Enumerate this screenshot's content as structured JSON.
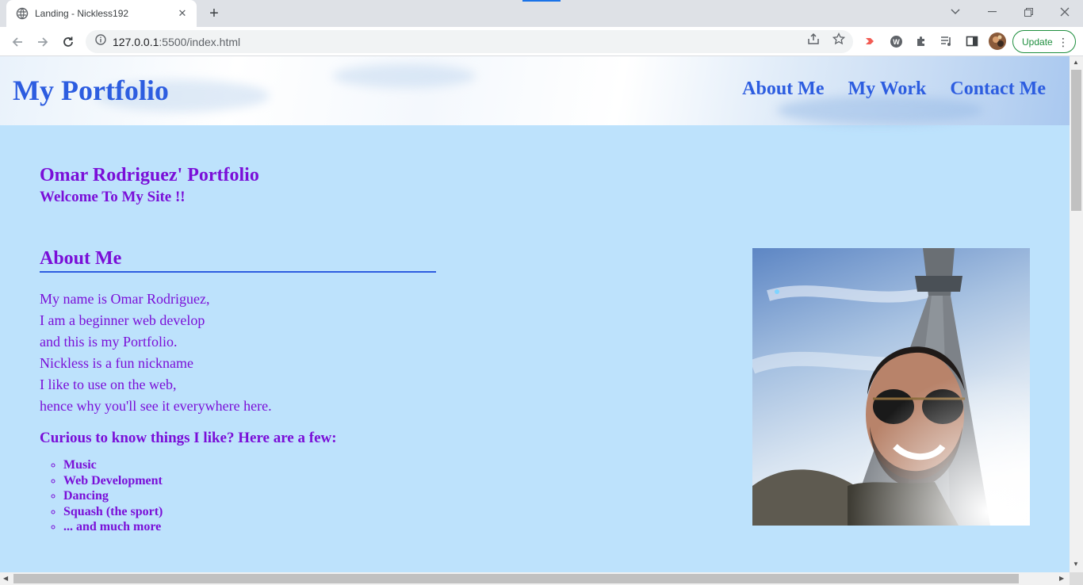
{
  "browser": {
    "tab_title": "Landing - Nickless192",
    "url_host": "127.0.0.1",
    "url_rest": ":5500/index.html",
    "update_label": "Update",
    "accent": "#1a73e8"
  },
  "site": {
    "logo": "My Portfolio",
    "nav": [
      "About Me",
      "My Work",
      "Contact Me"
    ],
    "hero_title": "Omar Rodriguez' Portfolio",
    "hero_subtitle": "Welcome To My Site !!",
    "about_heading": "About Me",
    "about_lines": [
      "My name is Omar Rodriguez,",
      "I am a beginner web develop",
      "and this is my Portfolio.",
      "Nickless is a fun nickname",
      "I like to use on the web,",
      "hence why you'll see it everywhere here."
    ],
    "likes_heading": "Curious to know things I like? Here are a few:",
    "likes": [
      "Music",
      "Web Development",
      "Dancing",
      "Squash (the sport)",
      "... and much more"
    ],
    "colors": {
      "background": "#bde2fc",
      "heading": "#7a0fd8",
      "nav": "#2d5de0"
    }
  }
}
